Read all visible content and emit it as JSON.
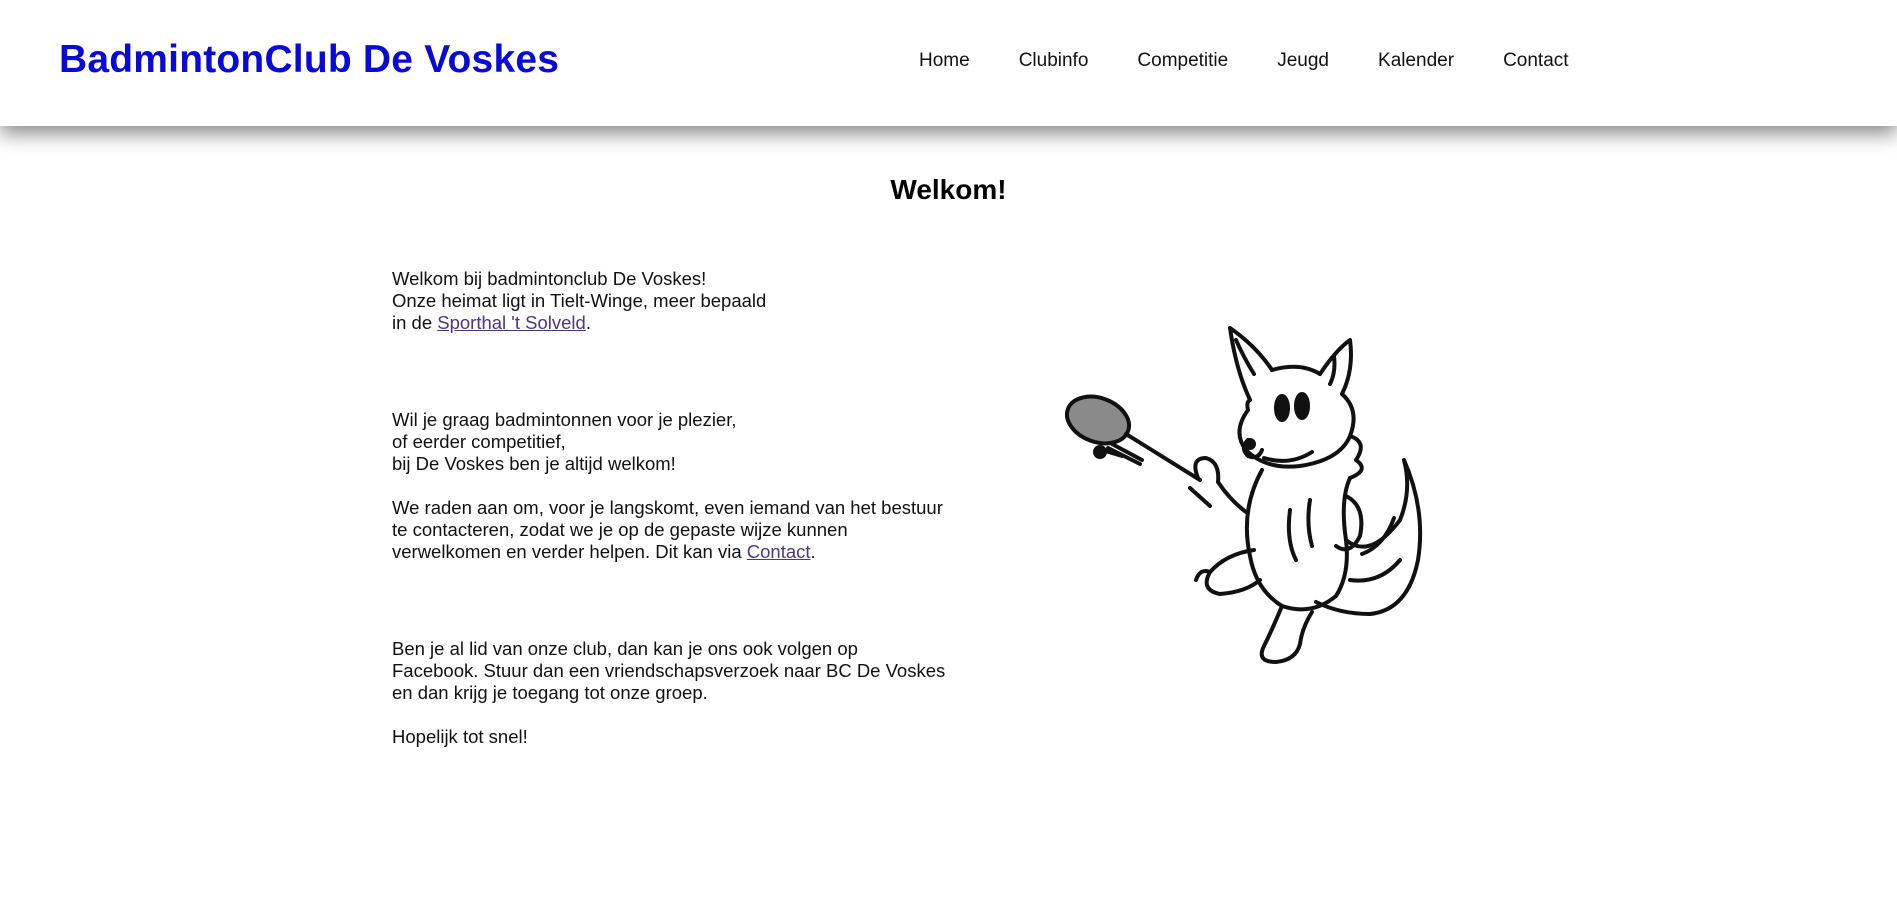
{
  "header": {
    "site_title": "BadmintonClub De Voskes",
    "nav": [
      {
        "label": "Home"
      },
      {
        "label": "Clubinfo"
      },
      {
        "label": "Competitie"
      },
      {
        "label": "Jeugd"
      },
      {
        "label": "Kalender"
      },
      {
        "label": "Contact"
      }
    ]
  },
  "main": {
    "title": "Welkom!",
    "intro": {
      "line1": "Welkom bij badmintonclub De Voskes!",
      "line2": "Onze heimat ligt in Tielt-Winge, meer bepaald",
      "line3_prefix": "in de ",
      "line3_link": "Sporthal 't Solveld",
      "line3_suffix": "."
    },
    "welcome": {
      "line1": "Wil je graag badmintonnen voor je plezier,",
      "line2": "of eerder competitief,",
      "line3": "bij De Voskes ben je altijd welkom!"
    },
    "contact_advice": {
      "line1": "We raden aan om, voor je langskomt, even iemand van het bestuur",
      "line2": "te contacteren, zodat we je op de gepaste wijze kunnen",
      "line3_prefix": "verwelkomen en verder helpen. Dit kan via ",
      "line3_link": "Contact",
      "line3_suffix": "."
    },
    "facebook": {
      "line1": "Ben je al lid van onze club, dan kan je ons ook volgen op",
      "line2": "Facebook. Stuur dan een vriendschapsverzoek naar BC De Voskes",
      "line3": "en dan krijg je toegang tot onze groep."
    },
    "closing": "Hopelijk tot snel!",
    "mascot_icon": "fox-badminton-mascot"
  },
  "colors": {
    "title_blue": "#0a0ad8",
    "link_purple": "#4b3585"
  }
}
